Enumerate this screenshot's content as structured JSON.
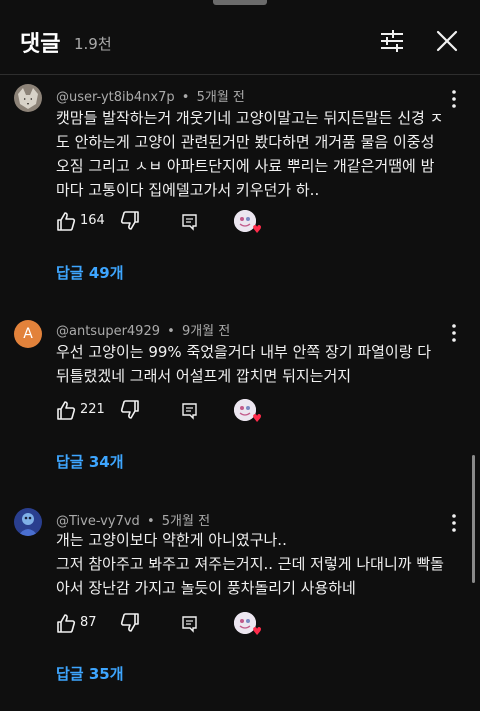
{
  "header": {
    "title": "댓글",
    "count": "1.9천"
  },
  "comments": [
    {
      "author": "@user-yt8ib4nx7p",
      "separator": "•",
      "time": "5개월 전",
      "text": "캣맘들 발작하는거 개웃기네 고양이말고는 뒤지든말든 신경 ㅈ\n도 안하는게 고양이 관련된거만 봤다하면 개거품 물음 이중성\n오짐 그리고 ㅅㅂ 아파트단지에 사료 뿌리는 개같은거땜에 밤\n마다 고통이다 집에델고가서 키우던가 하..",
      "likes": "164",
      "replies": "답글 49개"
    },
    {
      "author": "@antsuper4929",
      "separator": "•",
      "time": "9개월 전",
      "avatar_letter": "A",
      "text": "우선 고양이는 99% 죽었을거다 내부 안쪽 장기 파열이랑 다\n뒤틀렸겠네 그래서 어설프게 깝치면 뒤지는거지",
      "likes": "221",
      "replies": "답글 34개"
    },
    {
      "author": "@Tive-vy7vd",
      "separator": "•",
      "time": "5개월 전",
      "text": "개는 고양이보다 약한게 아니였구나..\n그저 참아주고 봐주고 져주는거지.. 근데 저렇게 나대니까 빡돌\n아서 장난감 가지고 놀듯이 풍차돌리기 사용하네",
      "likes": "87",
      "replies": "답글 35개"
    }
  ],
  "icons": {
    "filter": "sliders-icon",
    "close": "close-icon",
    "more": "kebab-icon",
    "like": "thumbs-up-icon",
    "dislike": "thumbs-down-icon",
    "reply": "comment-reply-icon",
    "heart": "creator-heart-icon"
  },
  "colors": {
    "background": "#0f0f0f",
    "replies_link": "#3ea6ff",
    "meta_text": "#aaaaaa",
    "avatar_A": "#e2823b",
    "heart": "#ff2b4a"
  }
}
